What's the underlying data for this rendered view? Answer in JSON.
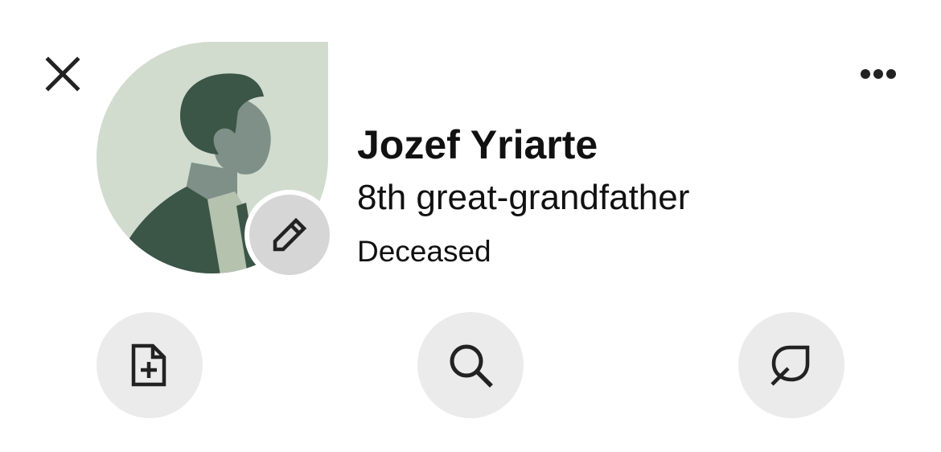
{
  "header": {
    "close_icon": "close-icon",
    "more_icon": "more-horizontal-icon"
  },
  "profile": {
    "name": "Jozef Yriarte",
    "relationship": "8th great-grandfather",
    "status": "Deceased",
    "avatar_icon": "male-silhouette-avatar",
    "edit_icon": "pencil-icon"
  },
  "actions": [
    {
      "icon": "add-record-icon"
    },
    {
      "icon": "search-icon"
    },
    {
      "icon": "leaf-hint-icon"
    }
  ],
  "colors": {
    "avatar_bg": "#d1dcce",
    "avatar_dark": "#3b5547",
    "avatar_mid": "#7e9087",
    "avatar_light": "#b4c2ae",
    "button_bg": "#ebebeb",
    "edit_bg": "#d6d6d6",
    "icon": "#222222"
  }
}
